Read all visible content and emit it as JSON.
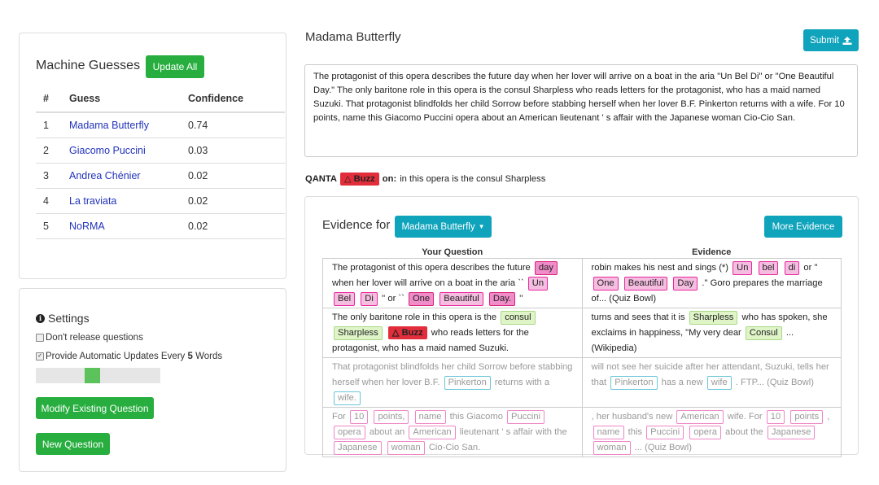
{
  "guesses_panel": {
    "title": "Machine Guesses",
    "update_all": "Update All",
    "headers": [
      "#",
      "Guess",
      "Confidence"
    ],
    "rows": [
      {
        "rank": "1",
        "guess": "Madama Butterfly",
        "confidence": "0.74"
      },
      {
        "rank": "2",
        "guess": "Giacomo Puccini",
        "confidence": "0.03"
      },
      {
        "rank": "3",
        "guess": "Andrea Chénier",
        "confidence": "0.02"
      },
      {
        "rank": "4",
        "guess": "La traviata",
        "confidence": "0.02"
      },
      {
        "rank": "5",
        "guess": "NoRMA",
        "confidence": "0.02"
      }
    ]
  },
  "settings": {
    "title": "Settings",
    "dont_release": "Don't release questions",
    "auto_updates_prefix": "Provide Automatic Updates Every ",
    "auto_updates_count": "5",
    "auto_updates_suffix": " Words",
    "slider_value_fraction": 0.5,
    "modify_button": "Modify Existing Question",
    "new_button": "New Question"
  },
  "main": {
    "title": "Madama Butterfly",
    "submit": "Submit",
    "question_text": "The protagonist of this opera describes the future day when her lover will arrive on a boat in the aria \"Un Bel Di\" or \"One Beautiful Day.\" The only baritone role in this opera is the consul Sharpless who reads letters for the protagonist, who has a maid named Suzuki. That protagonist blindfolds her child Sorrow before stabbing herself when her lover B.F. Pinkerton returns with a wife. For 10 points, name this Giacomo Puccini opera about an American lieutenant ' s affair with the Japanese woman Cio-Cio San.",
    "qanta_label": "QANTA",
    "buzz": "Buzz",
    "on_label": "on:",
    "buzz_context": "in this opera is the consul Sharpless"
  },
  "evidence": {
    "title": "Evidence for",
    "dropdown": "Madama Butterfly",
    "more": "More Evidence",
    "col_question": "Your Question",
    "col_evidence": "Evidence"
  },
  "colors": {
    "green": "#27ae3f",
    "teal": "#0fa3bc",
    "link": "#2233bb",
    "buzz_red": "#e22d3a"
  }
}
